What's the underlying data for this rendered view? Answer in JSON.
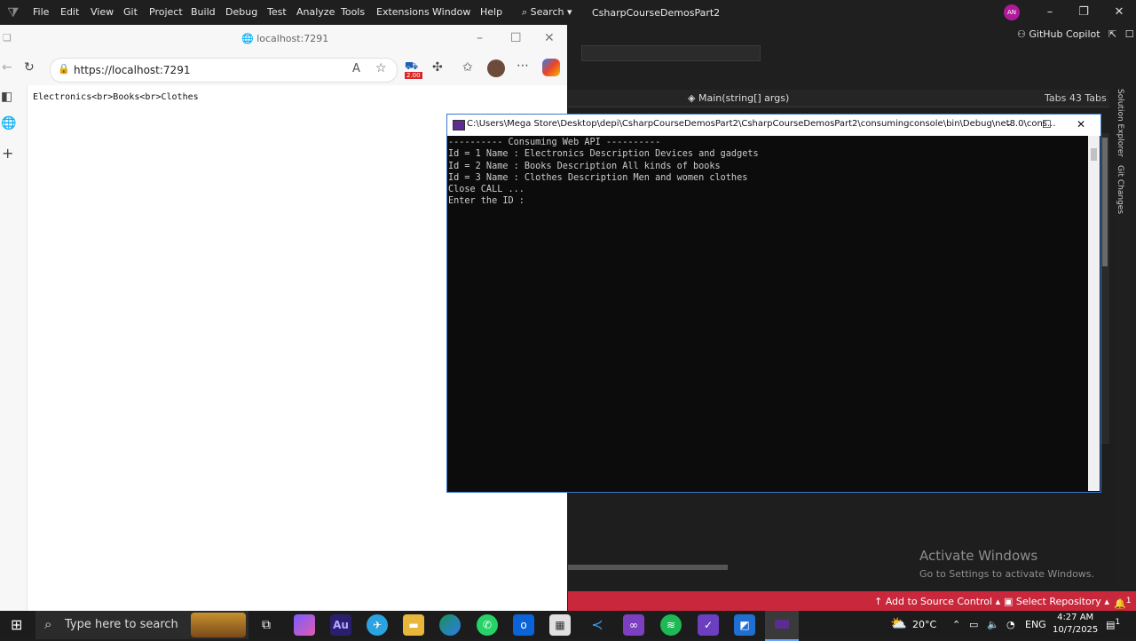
{
  "vs": {
    "menu": [
      "File",
      "Edit",
      "View",
      "Git",
      "Project",
      "Build",
      "Debug",
      "Test",
      "Analyze",
      "Tools",
      "Extensions",
      "Window",
      "Help"
    ],
    "search_label": "Search",
    "solution_name": "CsharpCourseDemosPart2",
    "avatar_initials": "AN",
    "copilot": "GitHub Copilot",
    "method_signature": "Main(string[] args)",
    "tabs_label": "Tabs 43 Tabs",
    "side_tabs": [
      "Solution Explorer",
      "Git Changes"
    ],
    "status": {
      "source_control": "Add to Source Control",
      "repo": "Select Repository",
      "notifications": "1"
    },
    "activate_title": "Activate Windows",
    "activate_sub": "Go to Settings to activate Windows."
  },
  "browser": {
    "window_title": "localhost:7291",
    "url": "https://localhost:7291",
    "extension_badge": "2.00",
    "page_text": "Electronics<br>Books<br>Clothes"
  },
  "console": {
    "title": "C:\\Users\\Mega Store\\Desktop\\depi\\CsharpCourseDemosPart2\\CsharpCourseDemosPart2\\consumingconsole\\bin\\Debug\\net8.0\\cons...",
    "lines": [
      "---------- Consuming Web API ----------",
      "Id = 1 Name : Electronics Description Devices and gadgets",
      "Id = 2 Name : Books Description All kinds of books",
      "Id = 3 Name : Clothes Description Men and women clothes",
      "Close CALL ...",
      "Enter the ID :"
    ]
  },
  "taskbar": {
    "search_placeholder": "Type here to search",
    "weather": "20°C",
    "language": "ENG",
    "time": "4:27 AM",
    "date": "10/7/2025",
    "notification_count": "1"
  },
  "colors": {
    "status_bar": "#c9283c",
    "console_border": "#3b78c9"
  }
}
